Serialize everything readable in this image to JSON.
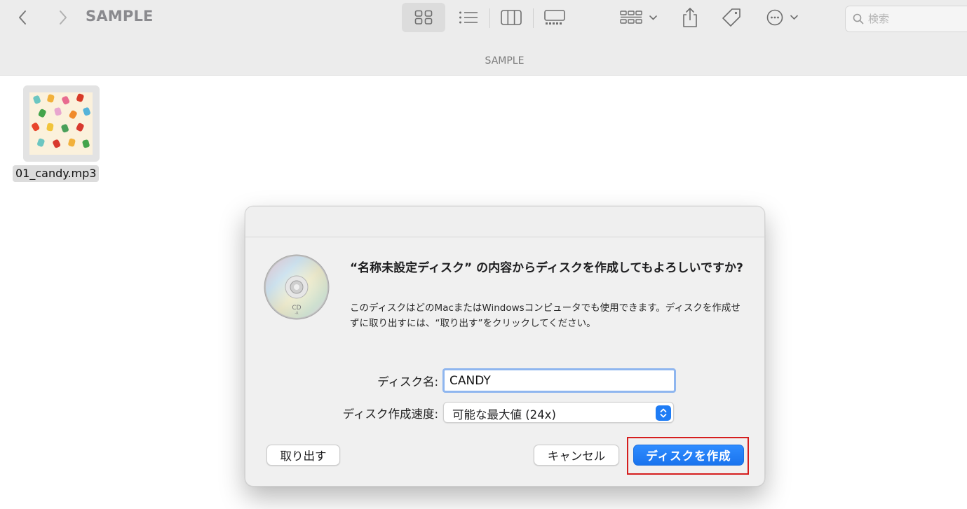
{
  "window": {
    "title": "SAMPLE",
    "path_title": "SAMPLE"
  },
  "toolbar": {
    "back_icon": "chevron-left-icon",
    "forward_icon": "chevron-right-icon",
    "view_icons": [
      "icon-view-icon",
      "list-view-icon",
      "column-view-icon",
      "gallery-view-icon"
    ],
    "selected_view": "icon-view",
    "group_icon": "group-icon",
    "share_icon": "share-icon",
    "tag_icon": "tag-icon",
    "action_icon": "ellipsis-circle-icon"
  },
  "search": {
    "placeholder": "検索"
  },
  "files": [
    {
      "name": "01_candy.mp3",
      "icon": "album-art-candy"
    }
  ],
  "dialog": {
    "icon": "cd-r-disc-icon",
    "disc_label": "CD",
    "disc_sublabel": "-R",
    "heading": "“名称未設定ディスク” の内容からディスクを作成してもよろしいですか?",
    "message": "このディスクはどのMacまたはWindowsコンピュータでも使用できます。ディスクを作成せずに取り出すには、“取り出す”をクリックしてください。",
    "disc_name_label": "ディスク名:",
    "disc_name_value": "CANDY",
    "speed_label": "ディスク作成速度:",
    "speed_value": "可能な最大値 (24x)",
    "eject_button": "取り出す",
    "cancel_button": "キャンセル",
    "burn_button": "ディスクを作成"
  },
  "colors": {
    "accent": "#1e7cf5",
    "highlight": "#d51e1e",
    "toolbar_bg": "#ececec"
  }
}
